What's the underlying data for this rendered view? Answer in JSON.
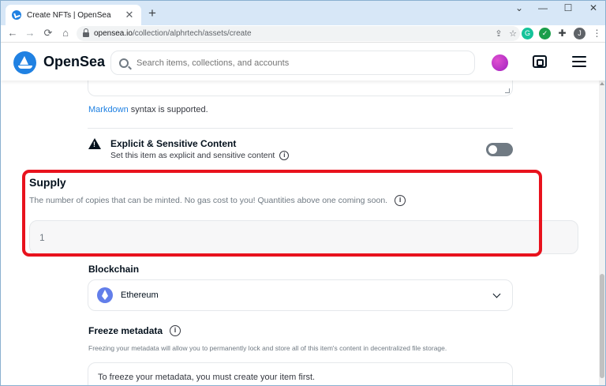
{
  "browser": {
    "tab_title": "Create NFTs | OpenSea",
    "tab_close": "✕",
    "new_tab": "+",
    "window_controls": {
      "minimize": "—",
      "maximize": "☐",
      "close": "✕",
      "dropdown": "⌄"
    },
    "url_domain": "opensea.io",
    "url_path": "/collection/alphrtech/assets/create",
    "profile_initial": "J",
    "ext_grammarly": "G",
    "menu_dots": "⋮"
  },
  "header": {
    "brand": "OpenSea",
    "search_placeholder": "Search items, collections, and accounts"
  },
  "description_section": {
    "markdown_link": "Markdown",
    "markdown_suffix": " syntax is supported."
  },
  "sensitive": {
    "title": "Explicit & Sensitive Content",
    "description": "Set this item as explicit and sensitive content",
    "enabled": false
  },
  "supply": {
    "title": "Supply",
    "description": "The number of copies that can be minted. No gas cost to you! Quantities above one coming soon.",
    "value": "1"
  },
  "blockchain": {
    "title": "Blockchain",
    "selected": "Ethereum"
  },
  "freeze": {
    "title": "Freeze metadata",
    "description": "Freezing your metadata will allow you to permanently lock and store all of this item's content in decentralized file storage.",
    "box_text": "To freeze your metadata, you must create your item first."
  },
  "info_glyph": "i",
  "colors": {
    "accent": "#2081e2",
    "highlight": "#e8121d",
    "ethereum": "#627eea"
  }
}
